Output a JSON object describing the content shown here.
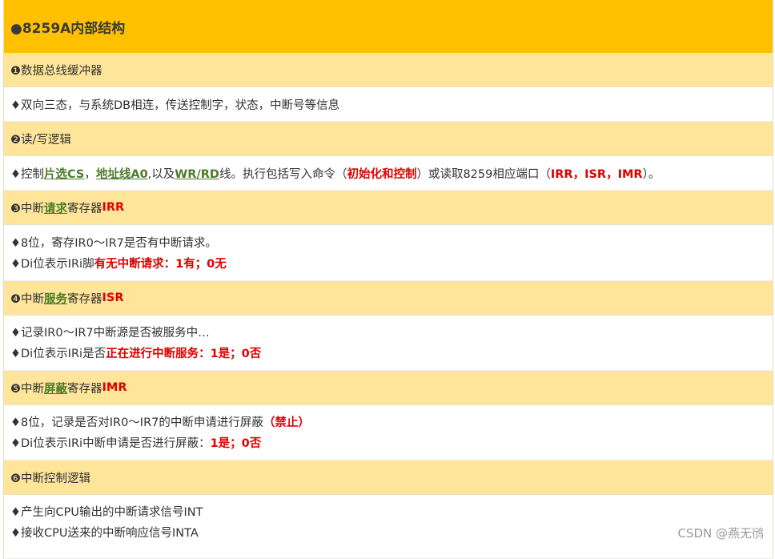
{
  "title": "●8259A内部结构",
  "sections": [
    {
      "heading": "❶数据总线缓冲器",
      "lines": [
        [
          "♦双向三态，与系统DB相连，传送控制字，状态，中断号等信息"
        ]
      ]
    },
    {
      "heading": "❷读/写逻辑",
      "lines": [
        [
          "♦控制",
          "片选CS",
          "，",
          "地址线A0",
          ",以及",
          "WR/RD",
          "线。执行包括写入命令（",
          "初始化和控制",
          "）或读取8259相应端口（",
          "IRR，ISR，IMR",
          "）。"
        ]
      ]
    },
    {
      "heading_parts": [
        "❸中断",
        "请求",
        "寄存器",
        "IRR"
      ],
      "lines": [
        [
          "♦8位，寄存IR0～IR7是否有中断请求。"
        ],
        [
          "♦Di位表示IRi脚",
          "有无中断请求：1有；0无"
        ]
      ]
    },
    {
      "heading_parts": [
        "❹中断",
        "服务",
        "寄存器",
        "ISR"
      ],
      "lines": [
        [
          "♦记录IR0～IR7中断源是否被服务中…"
        ],
        [
          "♦Di位表示IRi是否",
          "正在进行中断服务：1是；0否"
        ]
      ]
    },
    {
      "heading_parts": [
        "❺中断",
        "屏蔽",
        "寄存器",
        "IMR"
      ],
      "lines": [
        [
          "♦8位，记录是否对IR0～IR7的中断申请进行屏蔽",
          "（禁止）"
        ],
        [
          "♦Di位表示IRi中断申请是否进行屏蔽：",
          "1是；0否"
        ]
      ]
    },
    {
      "heading": "❻中断控制逻辑",
      "lines": [
        [
          "♦产生向CPU输出的中断请求信号INT"
        ],
        [
          "♦接收CPU送来的中断响应信号INTA"
        ]
      ]
    }
  ],
  "watermark": "CSDN @燕无鸻"
}
